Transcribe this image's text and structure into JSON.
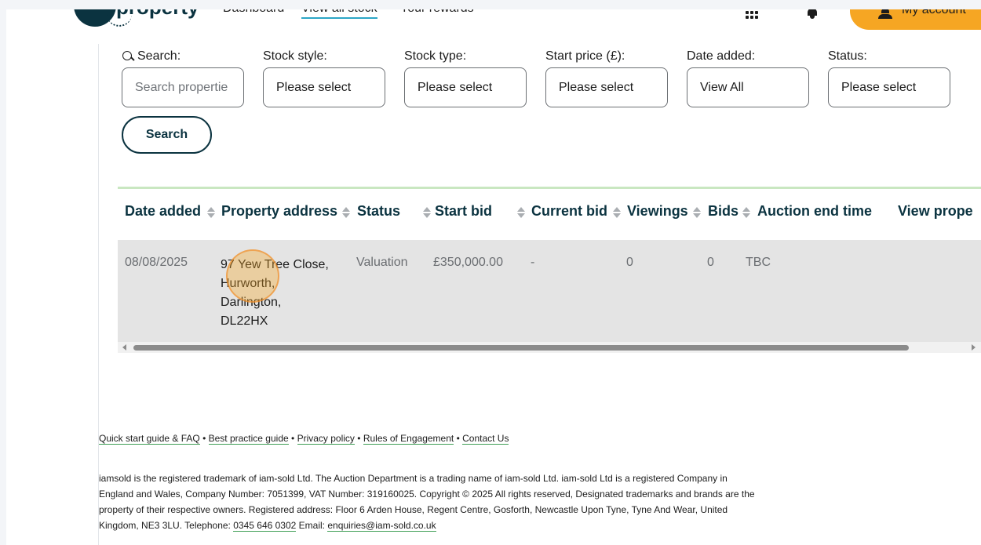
{
  "header": {
    "logo_text": "property",
    "nav": {
      "dashboard": "Dashboard",
      "view_all_stock": "View all stock",
      "your_rewards": "Your rewards"
    },
    "account_label": "My account"
  },
  "filters": {
    "search": {
      "label": "Search:",
      "placeholder": "Search propertie"
    },
    "stock_style": {
      "label": "Stock style:",
      "value": "Please select"
    },
    "stock_type": {
      "label": "Stock type:",
      "value": "Please select"
    },
    "start_price": {
      "label": "Start price (£):",
      "value": "Please select"
    },
    "date_added": {
      "label": "Date added:",
      "value": "View All"
    },
    "status": {
      "label": "Status:",
      "value": "Please select"
    },
    "search_button": "Search"
  },
  "table": {
    "columns": [
      "Date added",
      "Property address",
      "Status",
      "Start bid",
      "Current bid",
      "Viewings",
      "Bids",
      "Auction end time",
      "View prope"
    ],
    "rows": [
      {
        "date_added": "08/08/2025",
        "address_lines": [
          "97 Yew Tree Close,",
          "Hurworth,",
          "Darlington,",
          "DL22HX"
        ],
        "status": "Valuation",
        "start_bid": "£350,000.00",
        "current_bid": "-",
        "viewings": "0",
        "bids": "0",
        "auction_end_time": "TBC"
      }
    ]
  },
  "footer": {
    "links": [
      "Quick start guide & FAQ",
      "Best practice guide",
      "Privacy policy",
      "Rules of Engagement",
      "Contact Us"
    ],
    "separator": "•",
    "legal": {
      "text_1": "iamsold is the registered trademark of iam-sold Ltd. The Auction Department is a trading name of iam-sold Ltd. iam-sold Ltd is a registered Company in England and Wales, Company Number: 7051399, VAT Number: 319160025. Copyright © 2025 All rights reserved, Designated trademarks and brands are the property of their respective owners. Registered address: Floor 6 Arden House, Regent Centre, Gosforth, Newcastle Upon Tyne, Tyne And Wear, United Kingdom, NE3 3LU. Telephone: ",
      "phone": "0345 646 0302",
      "text_2": " Email: ",
      "email": "enquiries@iam-sold.co.uk"
    }
  },
  "colors": {
    "brand_navy": "#0b3340",
    "accent_orange": "#f6a623",
    "table_divider_green": "#c9e7c1",
    "link_underline_green": "#3f9e56",
    "row_background": "#e4e4e4"
  },
  "icons": [
    "search-icon",
    "sort-icon",
    "grid-icon",
    "bell-icon",
    "user-icon"
  ]
}
